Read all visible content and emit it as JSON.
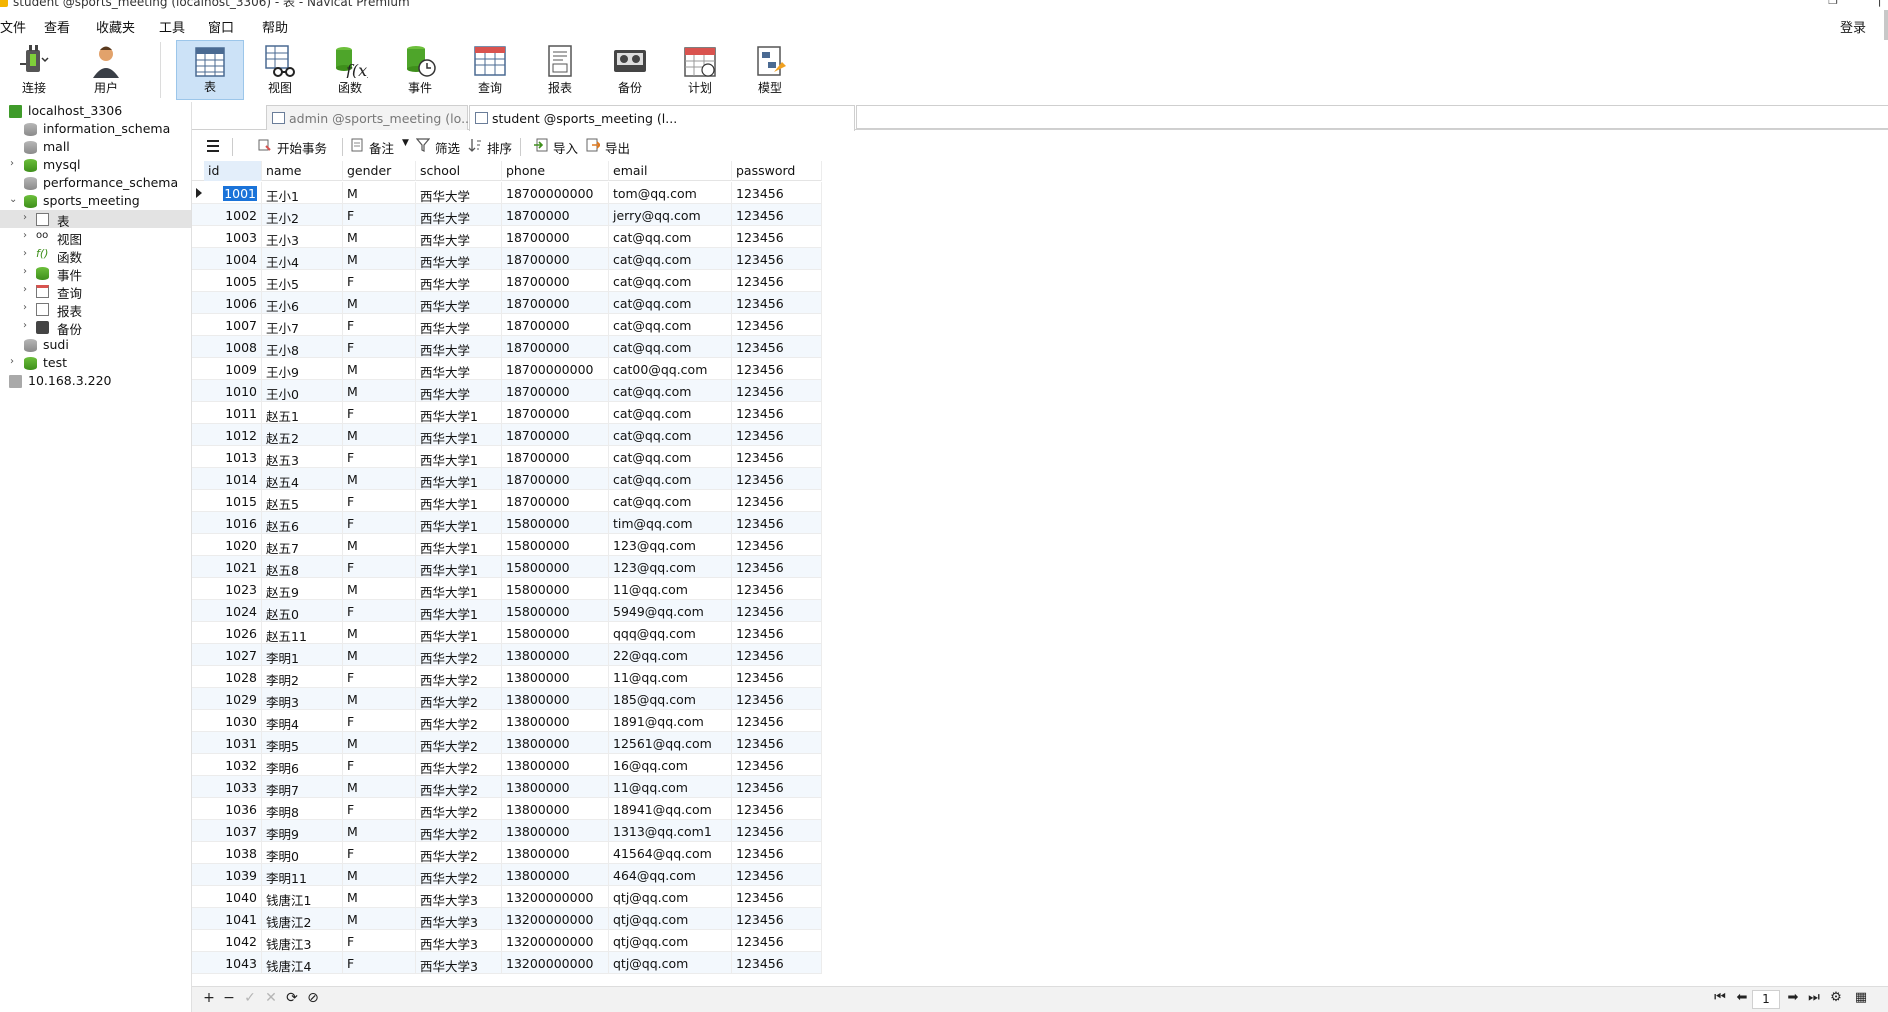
{
  "window": {
    "title": "student @sports_meeting (localhost_3306) - 表 - Navicat Premium"
  },
  "menubar": {
    "items": [
      "文件",
      "查看",
      "收藏夹",
      "工具",
      "窗口",
      "帮助"
    ],
    "login": "登录"
  },
  "toolbar": {
    "items": [
      {
        "label": "连接",
        "icon": "plug-icon"
      },
      {
        "label": "用户",
        "icon": "user-icon"
      },
      {
        "label": "表",
        "icon": "table-icon"
      },
      {
        "label": "视图",
        "icon": "view-icon"
      },
      {
        "label": "函数",
        "icon": "function-icon"
      },
      {
        "label": "事件",
        "icon": "event-icon"
      },
      {
        "label": "查询",
        "icon": "query-icon"
      },
      {
        "label": "报表",
        "icon": "report-icon"
      },
      {
        "label": "备份",
        "icon": "backup-icon"
      },
      {
        "label": "计划",
        "icon": "schedule-icon"
      },
      {
        "label": "模型",
        "icon": "model-icon"
      }
    ],
    "active": "表"
  },
  "sidebar": {
    "connections": [
      {
        "label": "localhost_3306",
        "status": "open"
      },
      {
        "label": "10.168.3.220",
        "status": "closed"
      }
    ],
    "databases": [
      "information_schema",
      "mall",
      "mysql",
      "performance_schema",
      "sports_meeting",
      "sudi",
      "test"
    ],
    "objects": [
      "表",
      "视图",
      "函数",
      "事件",
      "查询",
      "报表",
      "备份"
    ],
    "selected": "表"
  },
  "tabs": [
    {
      "label": "admin @sports_meeting (lo...",
      "active": false
    },
    {
      "label": "student @sports_meeting (l...",
      "active": true
    }
  ],
  "objbar": {
    "begin_transaction": "开始事务",
    "memo": "备注",
    "filter": "筛选",
    "sort": "排序",
    "import": "导入",
    "export": "导出"
  },
  "grid": {
    "columns": [
      "id",
      "name",
      "gender",
      "school",
      "phone",
      "email",
      "password"
    ],
    "rows": [
      [
        "1001",
        "王小1",
        "M",
        "西华大学",
        "18700000000",
        "tom@qq.com",
        "123456"
      ],
      [
        "1002",
        "王小2",
        "F",
        "西华大学",
        "18700000",
        "jerry@qq.com",
        "123456"
      ],
      [
        "1003",
        "王小3",
        "M",
        "西华大学",
        "18700000",
        "cat@qq.com",
        "123456"
      ],
      [
        "1004",
        "王小4",
        "M",
        "西华大学",
        "18700000",
        "cat@qq.com",
        "123456"
      ],
      [
        "1005",
        "王小5",
        "F",
        "西华大学",
        "18700000",
        "cat@qq.com",
        "123456"
      ],
      [
        "1006",
        "王小6",
        "M",
        "西华大学",
        "18700000",
        "cat@qq.com",
        "123456"
      ],
      [
        "1007",
        "王小7",
        "F",
        "西华大学",
        "18700000",
        "cat@qq.com",
        "123456"
      ],
      [
        "1008",
        "王小8",
        "F",
        "西华大学",
        "18700000",
        "cat@qq.com",
        "123456"
      ],
      [
        "1009",
        "王小9",
        "M",
        "西华大学",
        "18700000000",
        "cat00@qq.com",
        "123456"
      ],
      [
        "1010",
        "王小0",
        "M",
        "西华大学",
        "18700000",
        "cat@qq.com",
        "123456"
      ],
      [
        "1011",
        "赵五1",
        "F",
        "西华大学1",
        "18700000",
        "cat@qq.com",
        "123456"
      ],
      [
        "1012",
        "赵五2",
        "M",
        "西华大学1",
        "18700000",
        "cat@qq.com",
        "123456"
      ],
      [
        "1013",
        "赵五3",
        "F",
        "西华大学1",
        "18700000",
        "cat@qq.com",
        "123456"
      ],
      [
        "1014",
        "赵五4",
        "M",
        "西华大学1",
        "18700000",
        "cat@qq.com",
        "123456"
      ],
      [
        "1015",
        "赵五5",
        "F",
        "西华大学1",
        "18700000",
        "cat@qq.com",
        "123456"
      ],
      [
        "1016",
        "赵五6",
        "F",
        "西华大学1",
        "15800000",
        "tim@qq.com",
        "123456"
      ],
      [
        "1020",
        "赵五7",
        "M",
        "西华大学1",
        "15800000",
        "123@qq.com",
        "123456"
      ],
      [
        "1021",
        "赵五8",
        "F",
        "西华大学1",
        "15800000",
        "123@qq.com",
        "123456"
      ],
      [
        "1023",
        "赵五9",
        "M",
        "西华大学1",
        "15800000",
        "11@qq.com",
        "123456"
      ],
      [
        "1024",
        "赵五0",
        "F",
        "西华大学1",
        "15800000",
        "5949@qq.com",
        "123456"
      ],
      [
        "1026",
        "赵五11",
        "M",
        "西华大学1",
        "15800000",
        "qqq@qq.com",
        "123456"
      ],
      [
        "1027",
        "李明1",
        "M",
        "西华大学2",
        "13800000",
        "22@qq.com",
        "123456"
      ],
      [
        "1028",
        "李明2",
        "F",
        "西华大学2",
        "13800000",
        "11@qq.com",
        "123456"
      ],
      [
        "1029",
        "李明3",
        "M",
        "西华大学2",
        "13800000",
        "185@qq.com",
        "123456"
      ],
      [
        "1030",
        "李明4",
        "F",
        "西华大学2",
        "13800000",
        "1891@qq.com",
        "123456"
      ],
      [
        "1031",
        "李明5",
        "M",
        "西华大学2",
        "13800000",
        "12561@qq.com",
        "123456"
      ],
      [
        "1032",
        "李明6",
        "F",
        "西华大学2",
        "13800000",
        "16@qq.com",
        "123456"
      ],
      [
        "1033",
        "李明7",
        "M",
        "西华大学2",
        "13800000",
        "11@qq.com",
        "123456"
      ],
      [
        "1036",
        "李明8",
        "F",
        "西华大学2",
        "13800000",
        "18941@qq.com",
        "123456"
      ],
      [
        "1037",
        "李明9",
        "M",
        "西华大学2",
        "13800000",
        "1313@qq.com1",
        "123456"
      ],
      [
        "1038",
        "李明0",
        "F",
        "西华大学2",
        "13800000",
        "41564@qq.com",
        "123456"
      ],
      [
        "1039",
        "李明11",
        "M",
        "西华大学2",
        "13800000",
        "464@qq.com",
        "123456"
      ],
      [
        "1040",
        "钱唐江1",
        "M",
        "西华大学3",
        "13200000000",
        "qtj@qq.com",
        "123456"
      ],
      [
        "1041",
        "钱唐江2",
        "M",
        "西华大学3",
        "13200000000",
        "qtj@qq.com",
        "123456"
      ],
      [
        "1042",
        "钱唐江3",
        "F",
        "西华大学3",
        "13200000000",
        "qtj@qq.com",
        "123456"
      ],
      [
        "1043",
        "钱唐江4",
        "F",
        "西华大学3",
        "13200000000",
        "qtj@qq.com",
        "123456"
      ]
    ],
    "selected_row": 0
  },
  "bottombar": {
    "add": "+",
    "remove": "−",
    "apply": "✓",
    "discard": "✕",
    "refresh": "⟳",
    "stop": "⊘",
    "page": "1"
  },
  "colors": {
    "accent": "#1a73d9",
    "active_tool_bg": "#cce2f7",
    "db_green": "#4ea52a"
  }
}
